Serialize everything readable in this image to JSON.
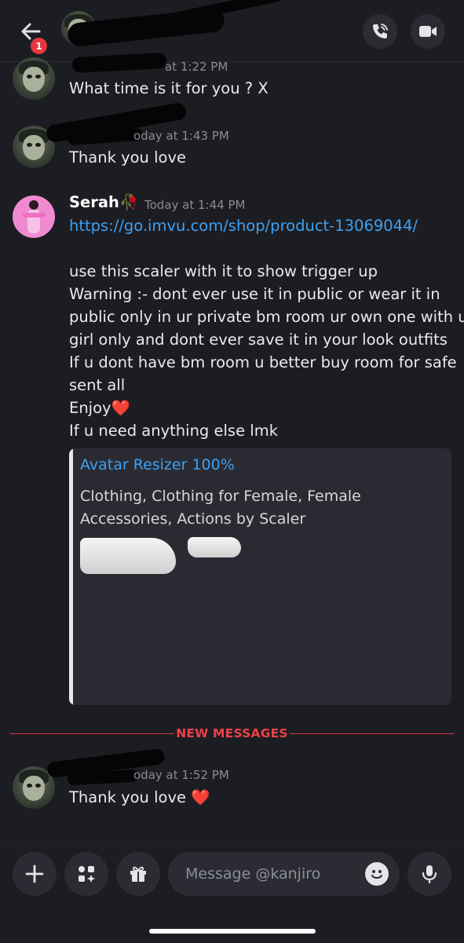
{
  "header": {
    "unread_count": "1"
  },
  "messages": [
    {
      "timestamp": "at 1:22 PM",
      "text": "What time is it for you ? X"
    },
    {
      "timestamp": "oday at 1:43 PM",
      "text": "Thank you love"
    },
    {
      "username": "Serah",
      "username_emoji": "🥀",
      "timestamp": "Today at 1:44 PM",
      "link": "https://go.imvu.com/shop/product-13069044/",
      "lines": [
        "use this scaler with it to show trigger up",
        "Warning :- dont ever use it in public or wear it in",
        "public only in ur private bm room ur own one with ur",
        "girl only and dont ever save it in your look outfits",
        "If u dont have bm room u better buy room for safe",
        "sent all",
        "Enjoy❤️",
        "If u need anything else lmk"
      ],
      "embed": {
        "title": "Avatar Resizer 100%",
        "description": "Clothing, Clothing for Female, Female Accessories, Actions by Scaler"
      }
    },
    {
      "timestamp": "oday at 1:52 PM",
      "text": "Thank you love ❤️"
    }
  ],
  "divider": {
    "label": "NEW MESSAGES",
    "color": "#ee4048"
  },
  "composer": {
    "placeholder": "Message @kanjiro"
  },
  "colors": {
    "background": "#1c1d22",
    "link": "#3ea0f2",
    "button_bg": "#2b2c33"
  }
}
